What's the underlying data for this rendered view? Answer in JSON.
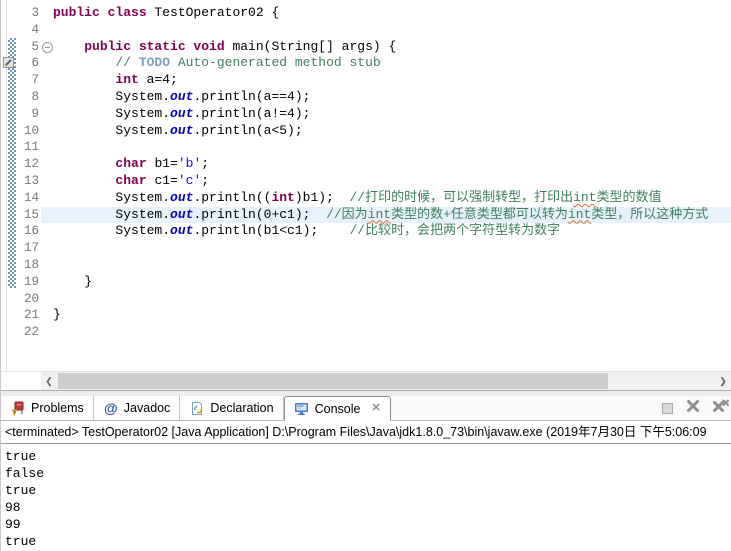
{
  "editor": {
    "current_line": "15",
    "fold_line": "5",
    "task_marker_line": "6",
    "range_indicator_lines": "5-19",
    "lines": [
      {
        "n": "3",
        "segs": [
          [
            "kw",
            "public class"
          ],
          [
            "pl",
            " TestOperator02 {"
          ]
        ]
      },
      {
        "n": "4",
        "segs": []
      },
      {
        "n": "5",
        "fold": true,
        "segs": [
          [
            "pl",
            "    "
          ],
          [
            "kw",
            "public static void"
          ],
          [
            "pl",
            " main(String[] args) {"
          ]
        ]
      },
      {
        "n": "6",
        "marker": "task",
        "segs": [
          [
            "pl",
            "        "
          ],
          [
            "cmt",
            "// "
          ],
          [
            "todo",
            "TODO"
          ],
          [
            "cmt",
            " Auto-generated method stub"
          ]
        ]
      },
      {
        "n": "7",
        "segs": [
          [
            "pl",
            "        "
          ],
          [
            "kw",
            "int"
          ],
          [
            "pl",
            " a=4;"
          ]
        ]
      },
      {
        "n": "8",
        "segs": [
          [
            "pl",
            "        System."
          ],
          [
            "fld",
            "out"
          ],
          [
            "pl",
            ".println(a==4);"
          ]
        ]
      },
      {
        "n": "9",
        "segs": [
          [
            "pl",
            "        System."
          ],
          [
            "fld",
            "out"
          ],
          [
            "pl",
            ".println(a!=4);"
          ]
        ]
      },
      {
        "n": "10",
        "segs": [
          [
            "pl",
            "        System."
          ],
          [
            "fld",
            "out"
          ],
          [
            "pl",
            ".println(a<5);"
          ]
        ]
      },
      {
        "n": "11",
        "segs": []
      },
      {
        "n": "12",
        "segs": [
          [
            "pl",
            "        "
          ],
          [
            "kw",
            "char"
          ],
          [
            "pl",
            " b1="
          ],
          [
            "str",
            "'b'"
          ],
          [
            "pl",
            ";"
          ]
        ]
      },
      {
        "n": "13",
        "segs": [
          [
            "pl",
            "        "
          ],
          [
            "kw",
            "char"
          ],
          [
            "pl",
            " c1="
          ],
          [
            "str",
            "'c'"
          ],
          [
            "pl",
            ";"
          ]
        ]
      },
      {
        "n": "14",
        "segs": [
          [
            "pl",
            "        System."
          ],
          [
            "fld",
            "out"
          ],
          [
            "pl",
            ".println(("
          ],
          [
            "kw",
            "int"
          ],
          [
            "pl",
            ")b1);  "
          ],
          [
            "cmt",
            "//打印的时候，可以强制转型，打印出"
          ],
          [
            "cmtsp",
            "int"
          ],
          [
            "cmt",
            "类型的数值"
          ]
        ]
      },
      {
        "n": "15",
        "current": true,
        "segs": [
          [
            "pl",
            "        System."
          ],
          [
            "fld",
            "out"
          ],
          [
            "pl",
            ".println(0+c1);  "
          ],
          [
            "cmt",
            "//因为"
          ],
          [
            "cmtsp",
            "int"
          ],
          [
            "cmt",
            "类型的数+任意类型都可以转为"
          ],
          [
            "cmtsp",
            "int"
          ],
          [
            "cmt",
            "类型，所以这种方式"
          ]
        ]
      },
      {
        "n": "16",
        "segs": [
          [
            "pl",
            "        System."
          ],
          [
            "fld",
            "out"
          ],
          [
            "pl",
            ".println(b1<c1);    "
          ],
          [
            "cmt",
            "//比较时，会把两个字符型转为数字"
          ]
        ]
      },
      {
        "n": "17",
        "segs": []
      },
      {
        "n": "18",
        "segs": []
      },
      {
        "n": "19",
        "segs": [
          [
            "pl",
            "    }"
          ]
        ]
      },
      {
        "n": "20",
        "segs": []
      },
      {
        "n": "21",
        "segs": [
          [
            "pl",
            "}"
          ]
        ]
      },
      {
        "n": "22",
        "segs": []
      }
    ]
  },
  "tabs": [
    {
      "label": "Problems",
      "icon": "problems-icon",
      "active": false
    },
    {
      "label": "Javadoc",
      "icon": "javadoc-icon",
      "active": false
    },
    {
      "label": "Declaration",
      "icon": "declaration-icon",
      "active": false
    },
    {
      "label": "Console",
      "icon": "console-icon",
      "active": true,
      "close_glyph": "✕"
    }
  ],
  "view_toolbar": [
    {
      "name": "terminate-button",
      "icon": "stop-square-icon",
      "enabled": false
    },
    {
      "name": "remove-launch-button",
      "icon": "remove-x-icon",
      "enabled": true
    },
    {
      "name": "remove-all-terminated-button",
      "icon": "remove-all-x-icon",
      "enabled": true
    }
  ],
  "console": {
    "header": "<terminated> TestOperator02 [Java Application] D:\\Program Files\\Java\\jdk1.8.0_73\\bin\\javaw.exe (2019年7月30日 下午5:06:09",
    "output": [
      "true",
      "false",
      "true",
      "98",
      "99",
      "true"
    ]
  },
  "colors": {
    "keyword": "#7f0055",
    "comment": "#3f7f5f",
    "string_literal": "#2a00ff",
    "static_field": "#0000c0",
    "task_tag": "#7f9fbf",
    "line_number": "#787878",
    "current_line_bg": "#e7f1fb",
    "range_indicator_blue": "#7193bc",
    "spell_squiggle": "#dd6b32"
  }
}
